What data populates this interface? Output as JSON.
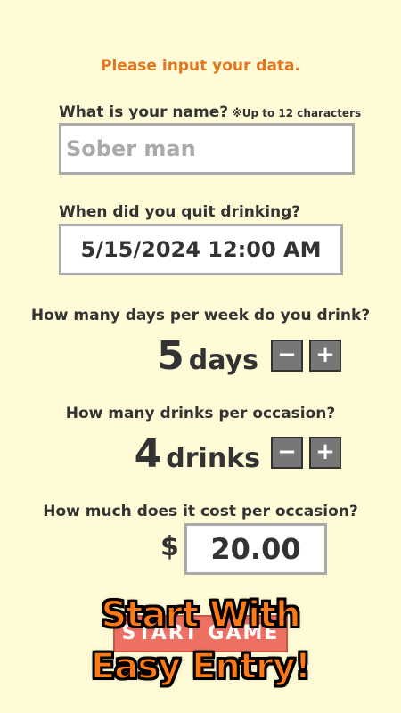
{
  "heading": "Please input your data.",
  "name": {
    "label": "What is your name?",
    "note": "※Up to 12 characters",
    "placeholder": "Sober man"
  },
  "quit_date": {
    "label": "When did you quit drinking?",
    "value": "5/15/2024  12:00 AM"
  },
  "days_per_week": {
    "label": "How many days per week do you drink?",
    "value": "5",
    "unit": "days"
  },
  "drinks_per_occasion": {
    "label": "How many drinks per occasion?",
    "value": "4",
    "unit": "drinks"
  },
  "cost": {
    "label": "How much does it cost per occasion?",
    "currency": "$",
    "value": "20.00"
  },
  "stepper": {
    "minus": "−",
    "plus": "+"
  },
  "start_button": "START GAME",
  "overlay": {
    "line1": "Start With",
    "line2": "Easy Entry!"
  },
  "colors": {
    "background": "#fffbd6",
    "heading": "#e3751e",
    "start_button": "#ee7063",
    "overlay_text": "#ff7a14",
    "stepper": "#777777"
  }
}
